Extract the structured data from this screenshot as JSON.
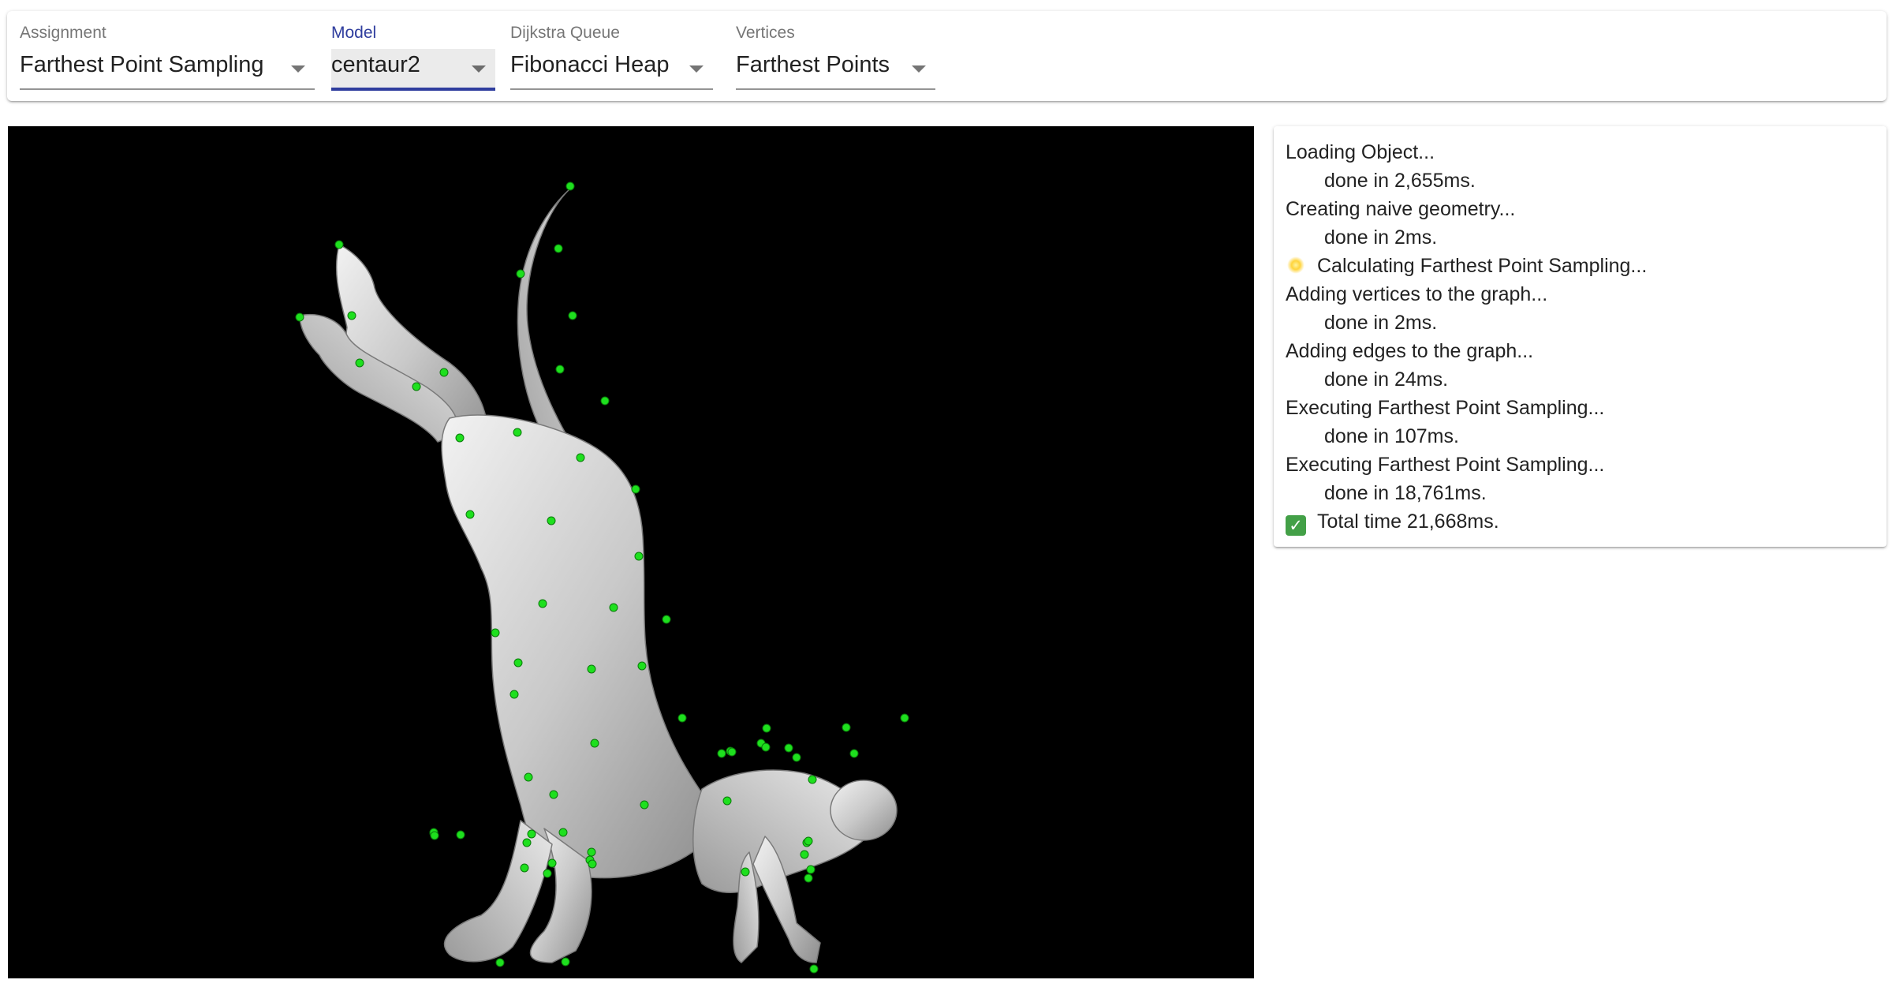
{
  "toolbar": {
    "assignment": {
      "label": "Assignment",
      "value": "Farthest Point Sampling"
    },
    "model": {
      "label": "Model",
      "value": "centaur2"
    },
    "queue": {
      "label": "Dijkstra Queue",
      "value": "Fibonacci Heap"
    },
    "vertices": {
      "label": "Vertices",
      "value": "Farthest Points"
    }
  },
  "viewport": {
    "background": "#000000",
    "mesh_color": "#c8c8c8",
    "point_color": "#22dd22",
    "icon": "centaur-mesh"
  },
  "log": [
    {
      "text": "Loading Object...",
      "indent": false
    },
    {
      "text": "done in 2,655ms.",
      "indent": true
    },
    {
      "text": "Creating naive geometry...",
      "indent": false
    },
    {
      "text": "done in 2ms.",
      "indent": true
    },
    {
      "text": "Calculating Farthest Point Sampling...",
      "indent": false,
      "icon": "sparkle-icon"
    },
    {
      "text": "Adding vertices to the graph...",
      "indent": false
    },
    {
      "text": "done in 2ms.",
      "indent": true
    },
    {
      "text": "Adding edges to the graph...",
      "indent": false
    },
    {
      "text": "done in 24ms.",
      "indent": true
    },
    {
      "text": "Executing Farthest Point Sampling...",
      "indent": false
    },
    {
      "text": "done in 107ms.",
      "indent": true
    },
    {
      "text": "Executing Farthest Point Sampling...",
      "indent": false
    },
    {
      "text": "done in 18,761ms.",
      "indent": true
    },
    {
      "text": "Total time 21,668ms.",
      "indent": false,
      "icon": "check-icon"
    }
  ]
}
